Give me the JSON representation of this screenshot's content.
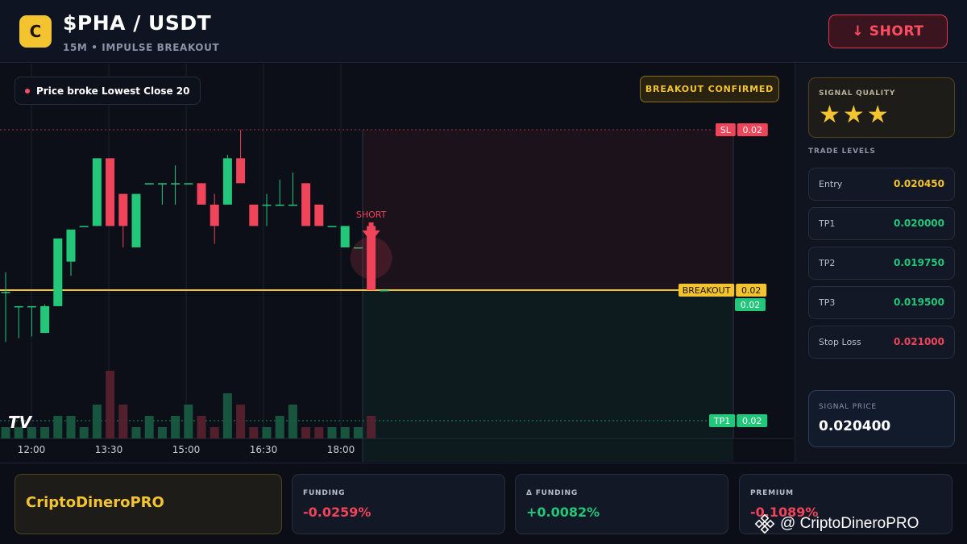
{
  "header": {
    "logo_letter": "C",
    "pair": "$PHA / USDT",
    "subtitle": "15M • IMPULSE BREAKOUT",
    "action_label": "↓ SHORT"
  },
  "chart": {
    "status_pill": "Price broke Lowest Close 20",
    "confirm_badge": "BREAKOUT CONFIRMED",
    "signal_marker_label": "SHORT",
    "logo_text": "TV",
    "colors": {
      "up": "#22c77a",
      "down": "#f0445a",
      "breakout": "#f4c430",
      "grid": "#1a2030"
    }
  },
  "chart_data": {
    "type": "candlestick",
    "x_ticks": [
      "12:00",
      "13:30",
      "15:00",
      "16:30",
      "18:00"
    ],
    "levels": [
      {
        "name": "SL",
        "label": "SL",
        "value_label": "0.02",
        "color": "#f0445a"
      },
      {
        "name": "BREAKOUT",
        "label": "BREAKOUT",
        "value_label": "0.02",
        "color": "#f4c430"
      },
      {
        "name": "current",
        "label": "",
        "value_label": "0.02",
        "color": "#22c77a"
      },
      {
        "name": "TP1",
        "label": "TP1",
        "value_label": "0.02",
        "color": "#22c77a"
      }
    ],
    "candles": [
      {
        "o": 0.020395,
        "h": 0.02045,
        "l": 0.020255,
        "c": 0.020395
      },
      {
        "o": 0.020355,
        "h": 0.020355,
        "l": 0.020265,
        "c": 0.020355
      },
      {
        "o": 0.020355,
        "h": 0.020355,
        "l": 0.02027,
        "c": 0.020355
      },
      {
        "o": 0.02028,
        "h": 0.02036,
        "l": 0.02028,
        "c": 0.020355
      },
      {
        "o": 0.020355,
        "h": 0.020545,
        "l": 0.020355,
        "c": 0.020545
      },
      {
        "o": 0.02048,
        "h": 0.02057,
        "l": 0.02044,
        "c": 0.02057
      },
      {
        "o": 0.02058,
        "h": 0.02058,
        "l": 0.02058,
        "c": 0.02058
      },
      {
        "o": 0.02058,
        "h": 0.02077,
        "l": 0.02058,
        "c": 0.02077
      },
      {
        "o": 0.02077,
        "h": 0.02077,
        "l": 0.02058,
        "c": 0.02058
      },
      {
        "o": 0.02067,
        "h": 0.02067,
        "l": 0.02052,
        "c": 0.02058
      },
      {
        "o": 0.02052,
        "h": 0.02067,
        "l": 0.02052,
        "c": 0.02067
      },
      {
        "o": 0.0207,
        "h": 0.0207,
        "l": 0.0207,
        "c": 0.0207
      },
      {
        "o": 0.0207,
        "h": 0.0207,
        "l": 0.02064,
        "c": 0.0207
      },
      {
        "o": 0.0207,
        "h": 0.02075,
        "l": 0.02064,
        "c": 0.0207
      },
      {
        "o": 0.0207,
        "h": 0.0207,
        "l": 0.0207,
        "c": 0.0207
      },
      {
        "o": 0.0207,
        "h": 0.0207,
        "l": 0.02064,
        "c": 0.02064
      },
      {
        "o": 0.02064,
        "h": 0.02067,
        "l": 0.02053,
        "c": 0.02058
      },
      {
        "o": 0.02064,
        "h": 0.02078,
        "l": 0.02064,
        "c": 0.02077
      },
      {
        "o": 0.02077,
        "h": 0.02085,
        "l": 0.0207,
        "c": 0.0207
      },
      {
        "o": 0.02064,
        "h": 0.02064,
        "l": 0.02058,
        "c": 0.02058
      },
      {
        "o": 0.02064,
        "h": 0.02067,
        "l": 0.02058,
        "c": 0.02064
      },
      {
        "o": 0.02064,
        "h": 0.02071,
        "l": 0.02064,
        "c": 0.02064
      },
      {
        "o": 0.02064,
        "h": 0.02073,
        "l": 0.02064,
        "c": 0.02064
      },
      {
        "o": 0.0207,
        "h": 0.0207,
        "l": 0.02058,
        "c": 0.02058
      },
      {
        "o": 0.02064,
        "h": 0.02064,
        "l": 0.02058,
        "c": 0.02058
      },
      {
        "o": 0.02058,
        "h": 0.02058,
        "l": 0.02058,
        "c": 0.02058
      },
      {
        "o": 0.02052,
        "h": 0.02058,
        "l": 0.02052,
        "c": 0.02058
      },
      {
        "o": 0.02052,
        "h": 0.02052,
        "l": 0.02052,
        "c": 0.02052
      },
      {
        "o": 0.02058,
        "h": 0.02058,
        "l": 0.0204,
        "c": 0.0204
      },
      {
        "o": 0.0204,
        "h": 0.0204,
        "l": 0.0204,
        "c": 0.0204
      }
    ],
    "volumes": [
      1,
      1,
      1,
      1,
      2,
      2,
      1,
      3,
      6,
      3,
      1,
      2,
      1,
      2,
      3,
      2,
      1,
      4,
      3,
      1,
      1,
      2,
      3,
      1,
      1,
      1,
      1,
      1,
      2,
      0
    ]
  },
  "sidebar": {
    "quality_label": "SIGNAL QUALITY",
    "stars": "★★★",
    "levels_title": "TRADE LEVELS",
    "levels": [
      {
        "label": "Entry",
        "value": "0.020450",
        "color": "#f4c430"
      },
      {
        "label": "TP1",
        "value": "0.020000",
        "color": "#22c77a"
      },
      {
        "label": "TP2",
        "value": "0.019750",
        "color": "#22c77a"
      },
      {
        "label": "TP3",
        "value": "0.019500",
        "color": "#22c77a"
      },
      {
        "label": "Stop Loss",
        "value": "0.021000",
        "color": "#f0445a"
      }
    ],
    "signal_label": "SIGNAL PRICE",
    "signal_value": "0.020400"
  },
  "footer": {
    "brand": "CriptoDineroPRO",
    "stats": [
      {
        "label": "FUNDING",
        "value": "-0.0259%",
        "color": "#f0445a"
      },
      {
        "label": "Δ FUNDING",
        "value": "+0.0082%",
        "color": "#22c77a"
      },
      {
        "label": "PREMIUM",
        "value": "-0.1089%",
        "color": "#f0445a"
      }
    ],
    "watermark": "@ CriptoDineroPRO"
  }
}
